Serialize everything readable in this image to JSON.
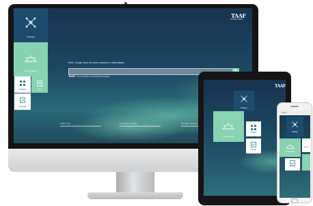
{
  "colors": {
    "tile_dark": "#1c4b6d",
    "tile_mint": "#88d3b2",
    "device_frame": "#151515"
  },
  "icons": [
    "network-icon",
    "sunrise-icon",
    "grid-icon",
    "list-icon",
    "checkbox-icon",
    "search-icon"
  ],
  "desktop": {
    "brand_logo": "TAAF",
    "brand_sub": "ANTARCTIQUE",
    "tiles": {
      "tile1_label": "Protégez",
      "tile2_label": "Connaissance",
      "tile3_label": "Activités",
      "tile4_label": "Infos",
      "tile5_label": "Interagir"
    },
    "search_label": "Rech. Google dans les terres australes et antarctiques",
    "search_placeholder": "",
    "logo_small": "TAAF",
    "note": "Terres australes et antarctiques françaises",
    "footer_left": "TAAF news",
    "footer_mid": "Les TAAF recrutent",
    "footer_right": "My TAAF account"
  },
  "tablet": {
    "brand_logo": "TAAF",
    "tile1_label": "Protégez",
    "tile2_label": "Connaissance",
    "tile3_label": "Activités",
    "tile5_label": "Interagir"
  },
  "phone": {
    "url": "taaf.fr",
    "tile1_label": "Protégez",
    "tile2_label": "Connaissance",
    "tile3_label": "Activités",
    "tile5_label": "Interagir"
  }
}
